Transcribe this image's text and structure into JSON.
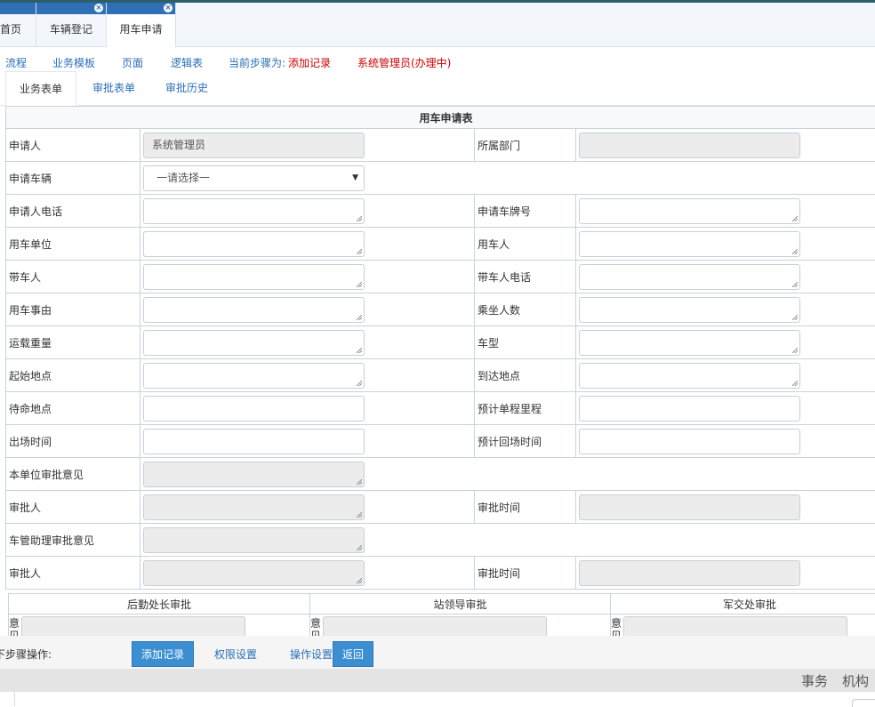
{
  "tabs": [
    {
      "label": "首页"
    },
    {
      "label": "车辆登记"
    },
    {
      "label": "用车申请"
    }
  ],
  "toolbar": {
    "flow": "流程",
    "template": "业务模板",
    "page": "页面",
    "logic": "逻辑表",
    "step_prefix": "当前步骤为:",
    "step_value": "添加记录",
    "handler": "系统管理员(办理中)"
  },
  "subtabs": [
    {
      "label": "业务表单"
    },
    {
      "label": "审批表单"
    },
    {
      "label": "审批历史"
    }
  ],
  "form": {
    "title": "用车申请表",
    "rows": [
      {
        "l1": "申请人",
        "v1": "系统管理员",
        "l2": "所属部门",
        "v2": ""
      },
      {
        "l1": "申请车辆",
        "sel": "一请选择一"
      },
      {
        "l1": "申请人电话",
        "l2": "申请车牌号"
      },
      {
        "l1": "用车单位",
        "l2": "用车人"
      },
      {
        "l1": "带车人",
        "l2": "带车人电话"
      },
      {
        "l1": "用车事由",
        "l2": "乘坐人数"
      },
      {
        "l1": "运载重量",
        "l2": "车型"
      },
      {
        "l1": "起始地点",
        "l2": "到达地点"
      },
      {
        "l1": "待命地点",
        "l2": "预计单程里程"
      },
      {
        "l1": "出场时间",
        "l2": "预计回场时间"
      },
      {
        "l1": "本单位审批意见"
      },
      {
        "l1": "审批人",
        "l2": "审批时间"
      },
      {
        "l1": "车管助理审批意见"
      },
      {
        "l1": "审批人",
        "l2": "审批时间"
      }
    ],
    "sub_headers": [
      "后勤处长审批",
      "站领导审批",
      "军交处审批"
    ],
    "opinion_label": "意见"
  },
  "bottom": {
    "label": "下步骤操作:",
    "add": "添加记录",
    "perm": "权限设置",
    "op": "操作设置",
    "back": "返回"
  },
  "status": {
    "a": "事务",
    "b": "机构"
  }
}
